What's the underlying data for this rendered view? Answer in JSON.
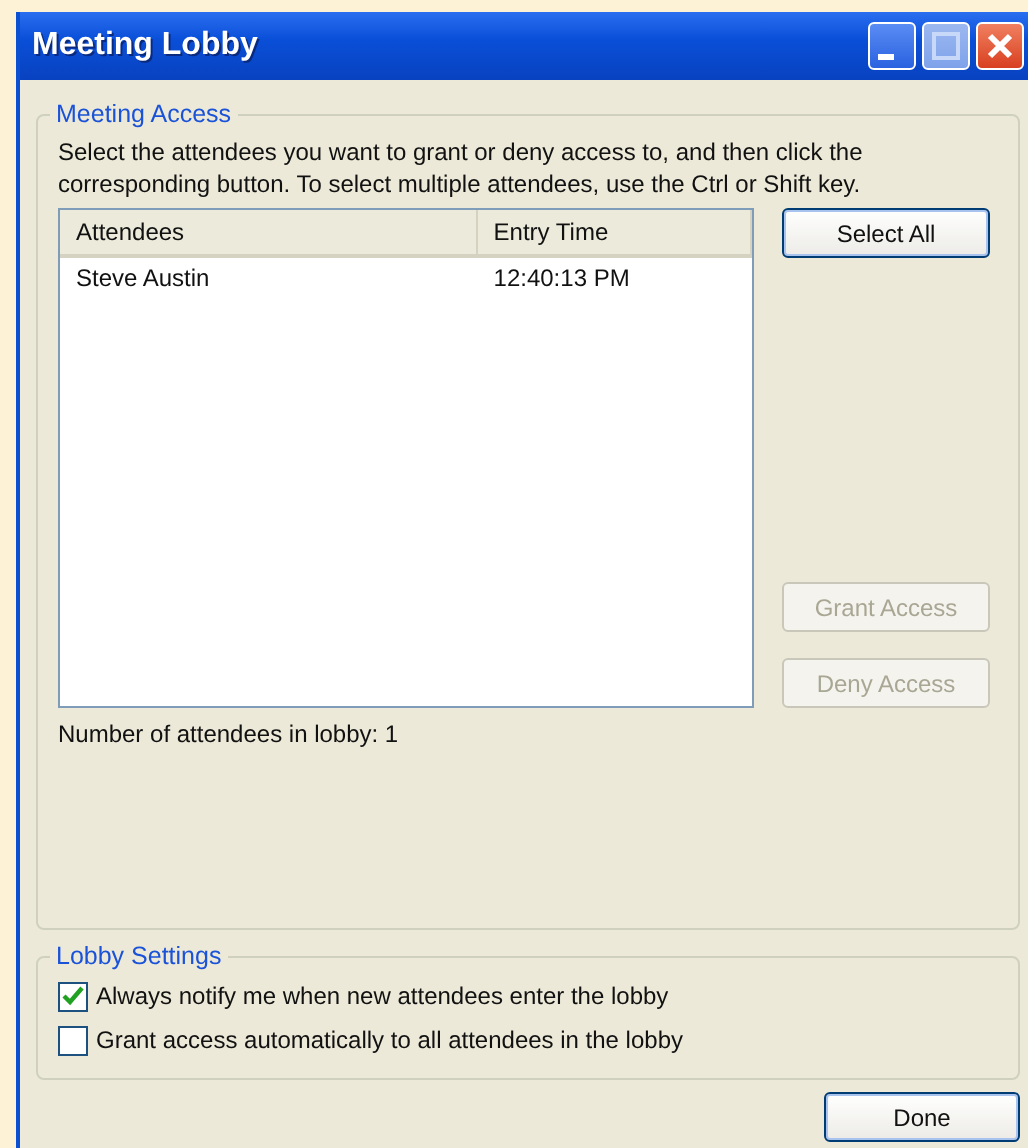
{
  "window": {
    "title": "Meeting Lobby"
  },
  "meeting_access": {
    "title": "Meeting Access",
    "instructions": "Select the attendees you want to grant or deny access to, and then click the corresponding button. To select multiple attendees, use the Ctrl or Shift key.",
    "table": {
      "columns": [
        "Attendees",
        "Entry Time"
      ],
      "rows": [
        {
          "cells": [
            "Steve Austin",
            "12:40:13 PM"
          ],
          "selected": false
        }
      ]
    },
    "buttons": [
      {
        "label": "Select All",
        "disabled": false
      },
      {
        "label": "Grant Access",
        "disabled": true
      },
      {
        "label": "Deny Access",
        "disabled": true
      }
    ],
    "count": "Number of attendees in lobby: 1"
  },
  "lobby_settings": {
    "title": "Lobby Settings",
    "options": [
      {
        "label": "Always notify me when new attendees enter the lobby",
        "checked": true
      },
      {
        "label": "Grant access automatically to all attendees in the lobby",
        "checked": false
      }
    ]
  },
  "done_button": {
    "label": "Done"
  }
}
